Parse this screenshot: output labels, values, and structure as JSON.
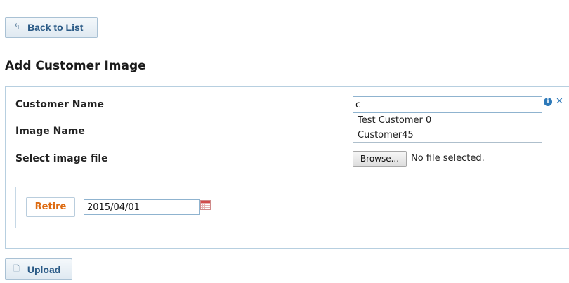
{
  "back_button": {
    "label": "Back to List",
    "icon": "undo-arrow-icon"
  },
  "page_title": "Add Customer Image",
  "form": {
    "customer_name": {
      "label": "Customer Name",
      "value": "c",
      "suggestions": [
        "Test Customer 0",
        "Customer45"
      ],
      "info_icon": "info-icon",
      "clear_icon": "clear-icon"
    },
    "image_name": {
      "label": "Image Name"
    },
    "image_file": {
      "label": "Select image file",
      "browse_label": "Browse...",
      "status": "No file selected."
    },
    "retire": {
      "button_label": "Retire",
      "date_value": "2015/04/01",
      "calendar_icon": "calendar-icon"
    }
  },
  "upload_button": {
    "label": "Upload",
    "icon": "file-icon"
  },
  "colors": {
    "accent": "#2a5a86",
    "retire_text": "#dd6b12",
    "panel_border": "#b7cfe0",
    "info_blue": "#2d79b9"
  }
}
